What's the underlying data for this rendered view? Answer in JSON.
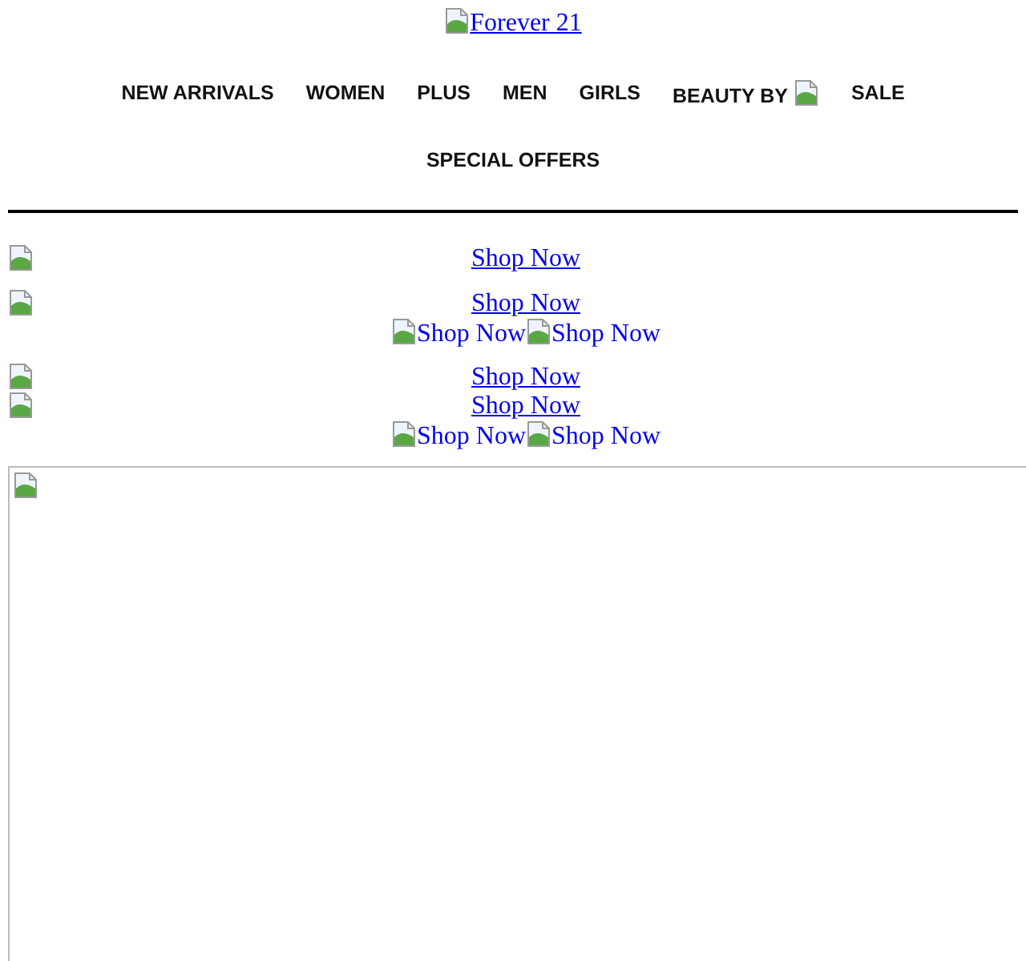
{
  "logo": {
    "alt": "Forever 21"
  },
  "nav": [
    {
      "label": "NEW ARRIVALS",
      "kind": "text"
    },
    {
      "label": "WOMEN",
      "kind": "text"
    },
    {
      "label": "PLUS",
      "kind": "text"
    },
    {
      "label": "MEN",
      "kind": "text"
    },
    {
      "label": "GIRLS",
      "kind": "text"
    },
    {
      "label": "BEAUTY BY",
      "kind": "image"
    },
    {
      "label": "SALE",
      "kind": "text"
    }
  ],
  "nav_second_line": [
    {
      "label": "SPECIAL OFFERS"
    }
  ],
  "blocks": [
    {
      "rows": [
        {
          "kind": "single",
          "links": [
            "Shop Now"
          ]
        }
      ]
    },
    {
      "rows": [
        {
          "kind": "single",
          "links": [
            "Shop Now"
          ]
        },
        {
          "kind": "pair",
          "links": [
            "Shop Now",
            "Shop Now"
          ]
        }
      ]
    },
    {
      "rows": [
        {
          "kind": "single",
          "links": [
            "Shop Now"
          ]
        },
        {
          "kind": "single",
          "links": [
            "Shop Now"
          ]
        },
        {
          "kind": "pair",
          "links": [
            "Shop Now",
            "Shop Now"
          ]
        }
      ]
    }
  ]
}
